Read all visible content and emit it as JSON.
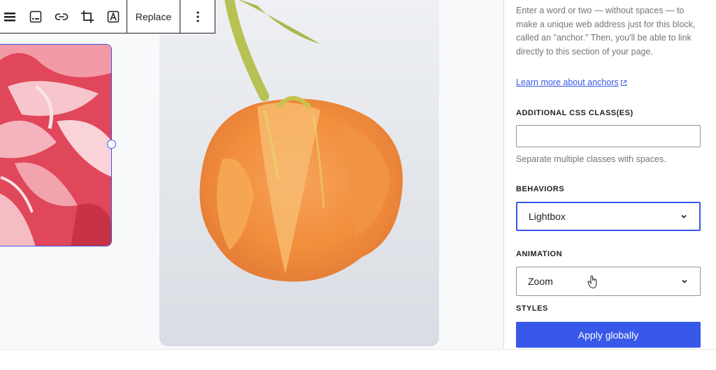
{
  "toolbar": {
    "replace_label": "Replace",
    "icons": [
      "align-icon",
      "caption-icon",
      "link-icon",
      "crop-icon",
      "text-overlay-icon",
      "more-options-icon"
    ]
  },
  "sidebar": {
    "anchor_help": "Enter a word or two — without spaces — to make a unique web address just for this block, called an \"anchor.\" Then, you'll be able to link directly to this section of your page.",
    "anchor_link": "Learn more about anchors",
    "css_label": "ADDITIONAL CSS CLASS(ES)",
    "css_value": "",
    "css_help": "Separate multiple classes with spaces.",
    "behaviors_label": "BEHAVIORS",
    "behaviors_value": "Lightbox",
    "animation_label": "ANIMATION",
    "animation_value": "Zoom",
    "styles_label": "STYLES",
    "apply_button": "Apply globally"
  },
  "colors": {
    "accent": "#3858e9",
    "text": "#1e1e1e",
    "muted": "#757575"
  }
}
